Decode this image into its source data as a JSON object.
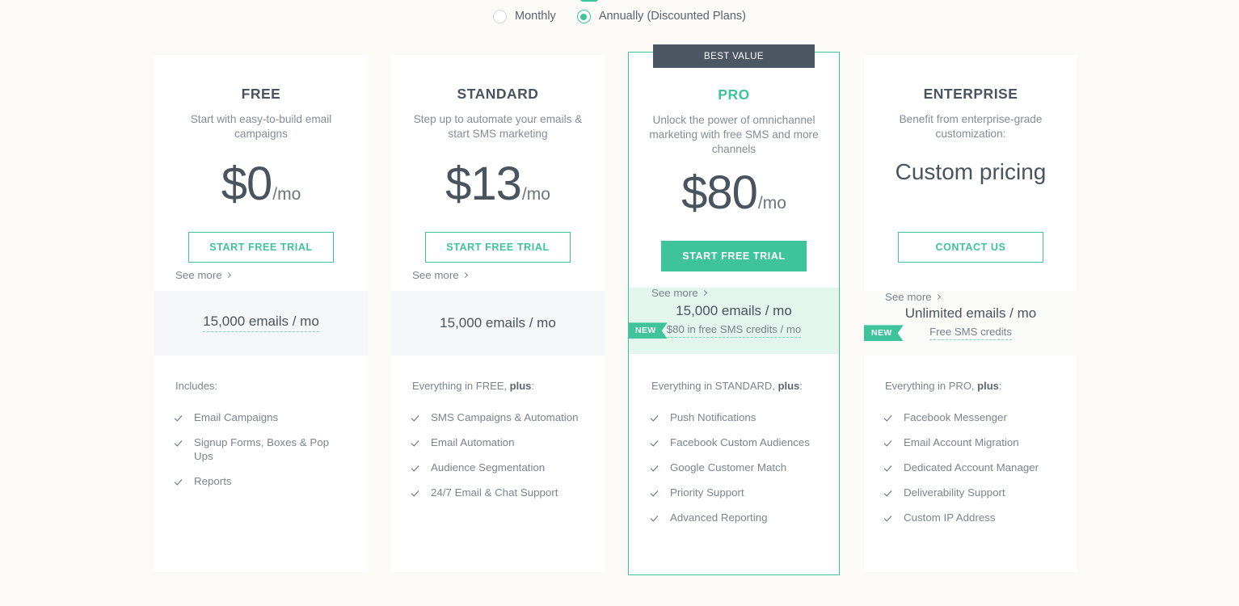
{
  "billing": {
    "options": [
      {
        "label": "Monthly",
        "selected": false
      },
      {
        "label": "Annually (Discounted Plans)",
        "selected": true
      }
    ]
  },
  "best_value_badge": "BEST VALUE",
  "colors": {
    "accent_green": "#3fc39a",
    "badge_dark": "#4c5763",
    "page_background": "#fbfaf6",
    "card_background": "#ffffff",
    "band_gray": "#f6f7f8",
    "band_green": "#e3f6ee"
  },
  "plans": [
    {
      "name": "FREE",
      "tagline": "Start with easy-to-build email campaigns",
      "price_main": "$0",
      "price_suffix": "/mo",
      "price_is_custom": false,
      "cta_label": "START FREE TRIAL",
      "quota_main": "15,000 emails / mo",
      "quota_main_dashed": true,
      "quota_sub": null,
      "new_badge": null,
      "features_intro_prefix": "Includes:",
      "features_intro_bold": null,
      "features_intro_suffix": null,
      "features": [
        "Email Campaigns",
        "Signup Forms, Boxes & Pop Ups",
        "Reports"
      ],
      "see_more_label": "See more"
    },
    {
      "name": "STANDARD",
      "tagline": "Step up to automate your emails & start SMS marketing",
      "price_main": "$13",
      "price_suffix": "/mo",
      "price_is_custom": false,
      "cta_label": "START FREE TRIAL",
      "quota_main": "15,000 emails / mo",
      "quota_main_dashed": false,
      "quota_sub": null,
      "new_badge": null,
      "features_intro_prefix": "Everything in FREE, ",
      "features_intro_bold": "plus",
      "features_intro_suffix": ":",
      "features": [
        "SMS Campaigns & Automation",
        "Email Automation",
        "Audience Segmentation",
        "24/7 Email & Chat Support"
      ],
      "see_more_label": "See more"
    },
    {
      "name": "PRO",
      "tagline": "Unlock the power of omnichannel marketing with free SMS and more channels",
      "price_main": "$80",
      "price_suffix": "/mo",
      "price_is_custom": false,
      "cta_label": "START FREE TRIAL",
      "quota_main": "15,000 emails / mo",
      "quota_main_dashed": false,
      "quota_sub": "$80 in free SMS credits / mo",
      "new_badge": "NEW",
      "features_intro_prefix": "Everything in STANDARD, ",
      "features_intro_bold": "plus",
      "features_intro_suffix": ":",
      "features": [
        "Push Notifications",
        "Facebook Custom Audiences",
        "Google Customer Match",
        "Priority Support",
        "Advanced Reporting"
      ],
      "see_more_label": "See more"
    },
    {
      "name": "ENTERPRISE",
      "tagline": "Benefit from enterprise-grade customization:",
      "price_main": "Custom pricing",
      "price_suffix": null,
      "price_is_custom": true,
      "cta_label": "CONTACT US",
      "quota_main": "Unlimited emails / mo",
      "quota_main_dashed": false,
      "quota_sub": "Free SMS credits",
      "new_badge": "NEW",
      "features_intro_prefix": "Everything in PRO, ",
      "features_intro_bold": "plus",
      "features_intro_suffix": ":",
      "features": [
        "Facebook Messenger",
        "Email Account Migration",
        "Dedicated Account Manager",
        "Deliverability Support",
        "Custom IP Address"
      ],
      "see_more_label": "See more"
    }
  ]
}
